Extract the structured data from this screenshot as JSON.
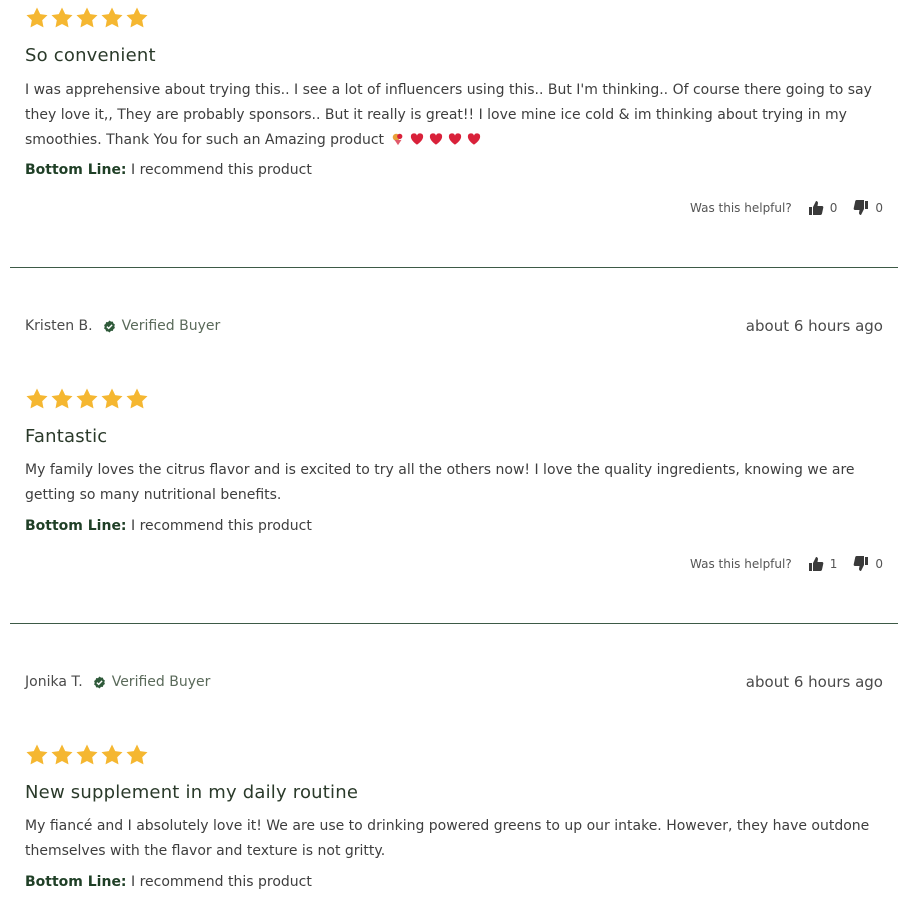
{
  "reviews": [
    {
      "author": "",
      "verified": "",
      "date": "",
      "rating": 5,
      "title": "So convenient",
      "body": "I was apprehensive about trying this.. I see a lot of influencers using this.. But I'm thinking.. Of course there going to say they love it,, They are probably sponsors.. But it really is great!! I love mine ice cold & im thinking about trying in my smoothies. Thank You for such an Amazing product",
      "emoji": [
        "heart-bouquet-emoji",
        "heart-emoji",
        "heart-emoji",
        "heart-emoji",
        "heart-emoji"
      ],
      "bottom_line_label": "Bottom Line:",
      "bottom_line_text": "I recommend this product",
      "helpful_label": "Was this helpful?",
      "up_count": "0",
      "down_count": "0"
    },
    {
      "author": "Kristen B.",
      "verified": "Verified Buyer",
      "date": "about 6 hours ago",
      "rating": 5,
      "title": "Fantastic",
      "body": "My family loves the citrus flavor and is excited to try all the others now! I love the quality ingredients, knowing we are getting so many nutritional benefits.",
      "bottom_line_label": "Bottom Line:",
      "bottom_line_text": "I recommend this product",
      "helpful_label": "Was this helpful?",
      "up_count": "1",
      "down_count": "0"
    },
    {
      "author": "Jonika T.",
      "verified": "Verified Buyer",
      "date": "about 6 hours ago",
      "rating": 5,
      "title": "New supplement in my daily routine",
      "body": "My fiancé and I absolutely love it! We are use to drinking powered greens to up our intake. However, they have outdone themselves with the flavor and texture is not gritty.",
      "bottom_line_label": "Bottom Line:",
      "bottom_line_text": "I recommend this product"
    }
  ],
  "colors": {
    "star": "#f5b731",
    "verified_check": "#2f5a3a",
    "divider": "#3d5a46",
    "bottom_line_label": "#1f3f26",
    "heart": "#d9213a"
  }
}
